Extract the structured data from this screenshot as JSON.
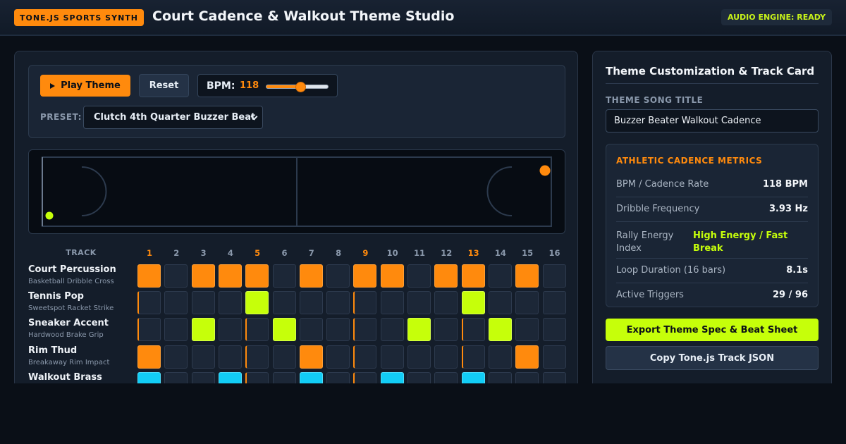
{
  "header": {
    "brand": "TONE.JS SPORTS SYNTH",
    "title": "Court Cadence & Walkout Theme Studio",
    "status": "AUDIO ENGINE: READY"
  },
  "controls": {
    "play_label": "Play Theme",
    "reset_label": "Reset",
    "bpm_label": "BPM:",
    "bpm_value": "118",
    "bpm_slider_fraction": 0.55,
    "preset_label": "PRESET:",
    "preset_selected": "Clutch 4th Quarter Buzzer Beat"
  },
  "sequencer": {
    "track_header": "TRACK",
    "steps": [
      "1",
      "2",
      "3",
      "4",
      "5",
      "6",
      "7",
      "8",
      "9",
      "10",
      "11",
      "12",
      "13",
      "14",
      "15",
      "16"
    ],
    "accent_steps": [
      1,
      5,
      9,
      13
    ],
    "tracks": [
      {
        "name": "Court Percussion",
        "sub": "Basketball Dribble Cross",
        "color": "orange",
        "pattern": [
          1,
          0,
          1,
          1,
          1,
          0,
          1,
          0,
          1,
          1,
          0,
          1,
          1,
          0,
          1,
          0
        ]
      },
      {
        "name": "Tennis Pop",
        "sub": "Sweetspot Racket Strike",
        "color": "lime",
        "pattern": [
          0,
          0,
          0,
          0,
          1,
          0,
          0,
          0,
          0,
          0,
          0,
          0,
          1,
          0,
          0,
          0
        ]
      },
      {
        "name": "Sneaker Accent",
        "sub": "Hardwood Brake Grip",
        "color": "lime",
        "pattern": [
          0,
          0,
          1,
          0,
          0,
          1,
          0,
          0,
          0,
          0,
          1,
          0,
          0,
          1,
          0,
          0
        ]
      },
      {
        "name": "Rim Thud",
        "sub": "Breakaway Rim Impact",
        "color": "orange",
        "pattern": [
          1,
          0,
          0,
          0,
          0,
          0,
          1,
          0,
          0,
          0,
          0,
          0,
          0,
          0,
          1,
          0
        ]
      },
      {
        "name": "Walkout Brass",
        "sub": "",
        "color": "cyan",
        "pattern": [
          1,
          0,
          0,
          1,
          0,
          0,
          1,
          0,
          0,
          1,
          0,
          0,
          1,
          0,
          0,
          0
        ]
      }
    ]
  },
  "side": {
    "title": "Theme Customization & Track Card",
    "song_title_label": "THEME SONG TITLE",
    "song_title_value": "Buzzer Beater Walkout Cadence",
    "metrics_heading": "ATHLETIC CADENCE METRICS",
    "metrics": [
      {
        "key": "BPM / Cadence Rate",
        "value": "118 BPM"
      },
      {
        "key": "Dribble Frequency",
        "value": "3.93 Hz"
      },
      {
        "key": "Rally Energy Index",
        "value": "High Energy / Fast Break"
      },
      {
        "key": "Loop Duration (16 bars)",
        "value": "8.1s"
      },
      {
        "key": "Active Triggers",
        "value": "29 / 96"
      }
    ],
    "export_label": "Export Theme Spec & Beat Sheet",
    "copy_label": "Copy Tone.js Track JSON"
  },
  "colors": {
    "accent_orange": "#ff8a0d",
    "accent_lime": "#c6ff0a",
    "accent_cyan": "#12cdf6",
    "background": "#0a0f17"
  },
  "icons": {
    "play": "play-icon",
    "chevron": "chevron-down-icon"
  }
}
